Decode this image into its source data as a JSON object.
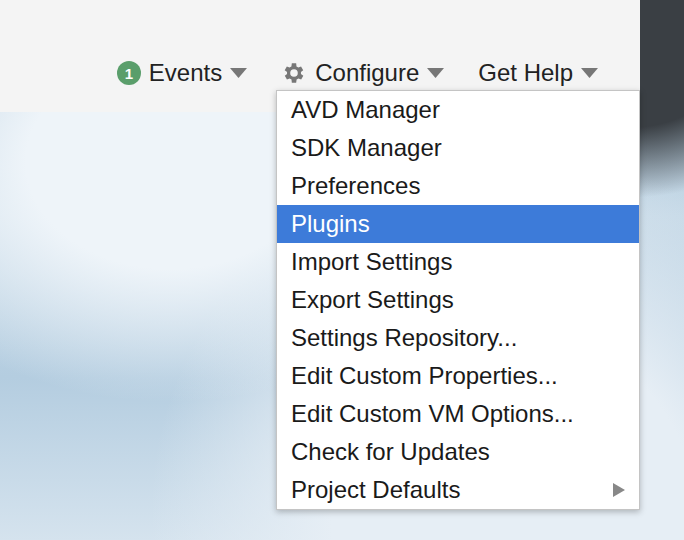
{
  "toolbar": {
    "items": [
      {
        "kind": "badge",
        "badge": "1",
        "label": "Events"
      },
      {
        "kind": "gear",
        "label": "Configure"
      },
      {
        "kind": "plain",
        "label": "Get Help"
      }
    ]
  },
  "menu": {
    "items": [
      {
        "label": "AVD Manager",
        "selected": false,
        "kind": "item"
      },
      {
        "label": "SDK Manager",
        "selected": false,
        "kind": "item"
      },
      {
        "label": "Preferences",
        "selected": false,
        "kind": "item"
      },
      {
        "label": "Plugins",
        "selected": true,
        "kind": "item"
      },
      {
        "label": "Import Settings",
        "selected": false,
        "kind": "item"
      },
      {
        "label": "Export Settings",
        "selected": false,
        "kind": "item"
      },
      {
        "label": "Settings Repository...",
        "selected": false,
        "kind": "item"
      },
      {
        "label": "Edit Custom Properties...",
        "selected": false,
        "kind": "item"
      },
      {
        "label": "Edit Custom VM Options...",
        "selected": false,
        "kind": "item"
      },
      {
        "label": "Check for Updates",
        "selected": false,
        "kind": "item"
      },
      {
        "label": "Project Defaults",
        "selected": false,
        "kind": "submenu"
      }
    ]
  }
}
